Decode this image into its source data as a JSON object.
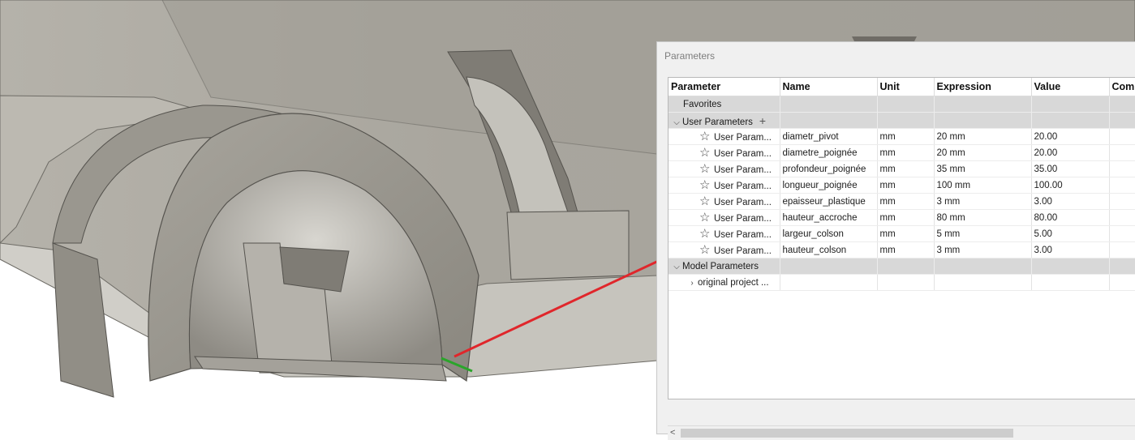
{
  "dialog": {
    "title": "Parameters",
    "columns": [
      "Parameter",
      "Name",
      "Unit",
      "Expression",
      "Value",
      "Comm"
    ],
    "groups": {
      "favorites": "Favorites",
      "user": "User Parameters",
      "model": "Model Parameters",
      "model_child": "original project ..."
    },
    "rows": [
      {
        "parameter": "User Param...",
        "name": "diametr_pivot",
        "unit": "mm",
        "expression": "20 mm",
        "value": "20.00"
      },
      {
        "parameter": "User Param...",
        "name": "diametre_poignée",
        "unit": "mm",
        "expression": "20 mm",
        "value": "20.00"
      },
      {
        "parameter": "User Param...",
        "name": "profondeur_poignée",
        "unit": "mm",
        "expression": "35 mm",
        "value": "35.00"
      },
      {
        "parameter": "User Param...",
        "name": "longueur_poignée",
        "unit": "mm",
        "expression": "100 mm",
        "value": "100.00"
      },
      {
        "parameter": "User Param...",
        "name": "epaisseur_plastique",
        "unit": "mm",
        "expression": "3 mm",
        "value": "3.00"
      },
      {
        "parameter": "User Param...",
        "name": "hauteur_accroche",
        "unit": "mm",
        "expression": "80 mm",
        "value": "80.00"
      },
      {
        "parameter": "User Param...",
        "name": "largeur_colson",
        "unit": "mm",
        "expression": "5 mm",
        "value": "5.00"
      },
      {
        "parameter": "User Param...",
        "name": "hauteur_colson",
        "unit": "mm",
        "expression": "3 mm",
        "value": "3.00"
      }
    ]
  },
  "icons": {
    "expand": "chevron-down-icon",
    "collapsed": "chevron-right-icon",
    "favorite": "star-outline-icon",
    "add": "plus-icon",
    "scroll_left": "chevron-left-icon"
  },
  "colors": {
    "annotation_line": "#e0262b",
    "highlight_edge": "#2aa52a",
    "group_row_bg": "#d8d8d8"
  }
}
